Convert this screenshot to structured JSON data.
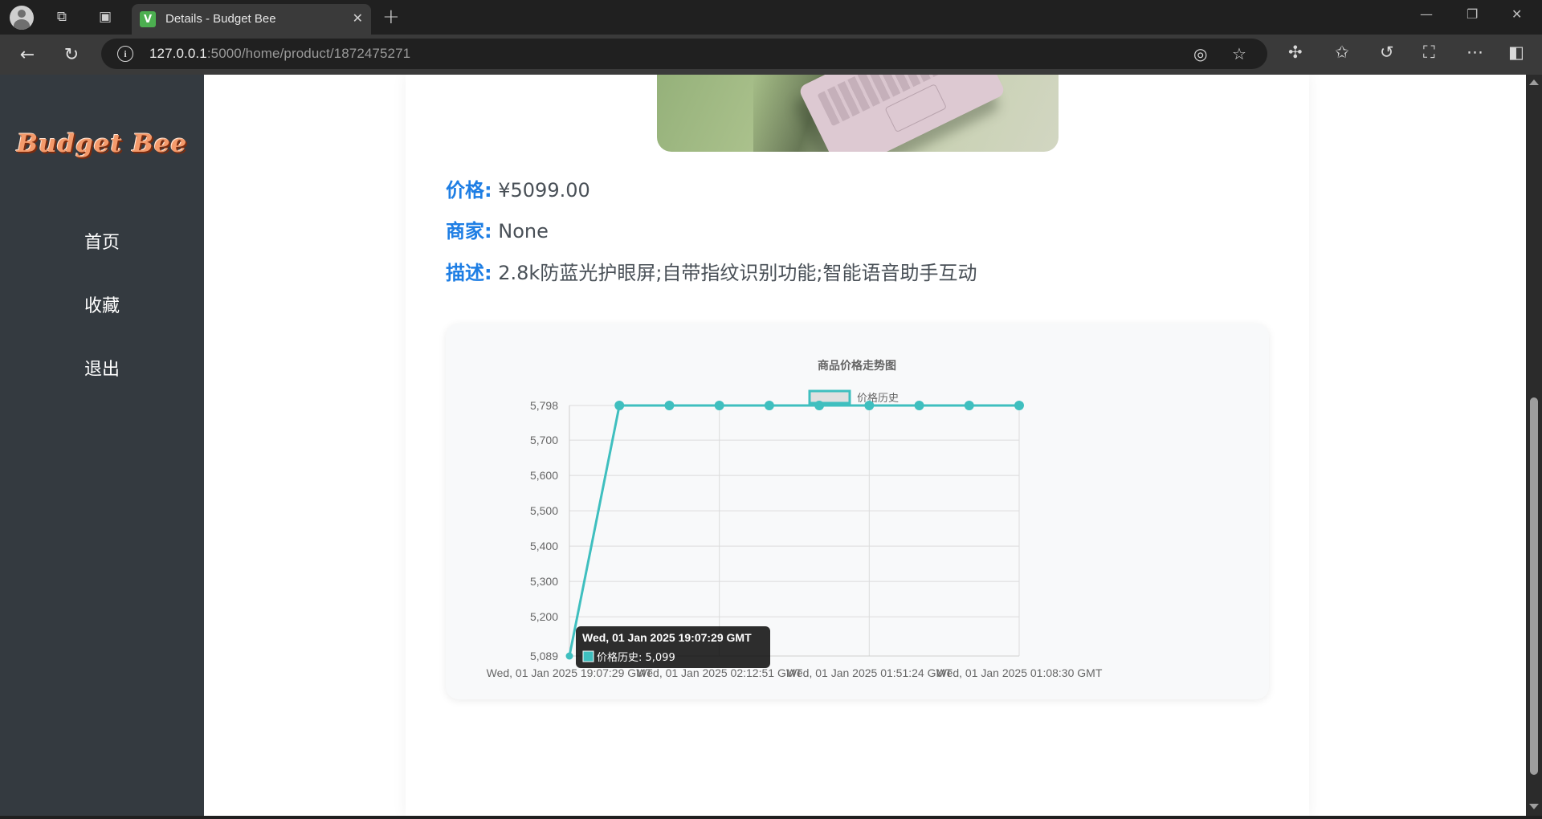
{
  "browser": {
    "tab_title": "Details - Budget Bee",
    "favicon_letter": "V",
    "url_host": "127.0.0.1",
    "url_rest": ":5000/home/product/1872475271"
  },
  "sidebar": {
    "logo": "Budget Bee",
    "items": [
      {
        "label": "首页"
      },
      {
        "label": "收藏"
      },
      {
        "label": "退出"
      }
    ]
  },
  "product": {
    "price_label": "价格:",
    "price_value": "¥5099.00",
    "merchant_label": "商家:",
    "merchant_value": "None",
    "desc_label": "描述:",
    "desc_value": "2.8k防蓝光护眼屏;自带指纹识别功能;智能语音助手互动"
  },
  "colors": {
    "accent": "#1e7ee4",
    "series": "#3fbfbf",
    "sidebar_bg": "#343a40"
  },
  "chart_data": {
    "type": "line",
    "title": "商品价格走势图",
    "legend": "top",
    "grid": true,
    "series": [
      {
        "name": "价格历史",
        "values": [
          5089,
          5798,
          5798,
          5798,
          5798,
          5798,
          5798,
          5798,
          5798,
          5798
        ]
      }
    ],
    "x_tick_labels": [
      "Wed, 01 Jan 2025 19:07:29 GMT",
      "Wed, 01 Jan 2025 02:12:51 GMT",
      "Wed, 01 Jan 2025 01:51:24 GMT",
      "Wed, 01 Jan 2025 01:08:30 GMT"
    ],
    "y_tick_labels": [
      "5,798",
      "5,700",
      "5,600",
      "5,500",
      "5,400",
      "5,300",
      "5,200",
      "5,089"
    ],
    "ylim": [
      5089,
      5798
    ],
    "tooltip": {
      "title": "Wed, 01 Jan 2025 19:07:29 GMT",
      "label": "价格历史: 5,099"
    }
  }
}
